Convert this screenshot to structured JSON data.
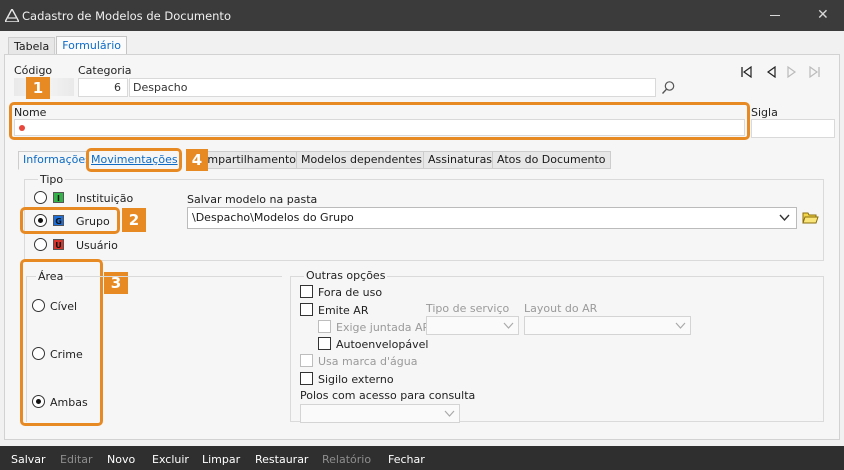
{
  "window": {
    "title": "Cadastro de Modelos de Documento"
  },
  "top_tabs": [
    {
      "label": "Tabela"
    },
    {
      "label": "Formulário"
    }
  ],
  "fields": {
    "codigo_label": "Código",
    "categoria_label": "Categoria",
    "categoria_code": "6",
    "categoria_value": "Despacho",
    "nome_label": "Nome",
    "sigla_label": "Sigla"
  },
  "badges": [
    "1",
    "2",
    "3",
    "4"
  ],
  "sub_tabs": [
    {
      "label": "Informações"
    },
    {
      "label": "Movimentações"
    },
    {
      "label": "Compartilhamentos"
    },
    {
      "label": "Modelos dependentes"
    },
    {
      "label": "Assinaturas"
    },
    {
      "label": "Atos do Documento"
    }
  ],
  "tipo": {
    "title": "Tipo",
    "options": [
      {
        "label": "Instituição",
        "icon_letter": "I",
        "icon_color": "#35b34a"
      },
      {
        "label": "Grupo",
        "icon_letter": "G",
        "icon_color": "#1e6fd9"
      },
      {
        "label": "Usuário",
        "icon_letter": "U",
        "icon_color": "#d9342b"
      }
    ],
    "selected": "Grupo"
  },
  "pasta": {
    "label": "Salvar modelo na pasta",
    "value": "\\Despacho\\Modelos do Grupo"
  },
  "area": {
    "title": "Área",
    "options": [
      {
        "label": "Cível"
      },
      {
        "label": "Crime"
      },
      {
        "label": "Ambas"
      }
    ],
    "selected": "Ambas"
  },
  "outras": {
    "title": "Outras opções",
    "fora_de_uso": "Fora de uso",
    "emite_ar": "Emite AR",
    "exige_juntada_ar": "Exige juntada AR",
    "autoenvelopavel": "Autoenvelopável",
    "usa_marca_dagua": "Usa marca d'água",
    "sigilo_externo": "Sigilo externo",
    "tipo_servico_label": "Tipo de serviço",
    "layout_ar_label": "Layout do AR",
    "polos_label": "Polos com acesso para consulta"
  },
  "bottom_buttons": [
    {
      "label": "Salvar",
      "enabled": true
    },
    {
      "label": "Editar",
      "enabled": false
    },
    {
      "label": "Novo",
      "enabled": true
    },
    {
      "label": "Excluir",
      "enabled": true
    },
    {
      "label": "Limpar",
      "enabled": true
    },
    {
      "label": "Restaurar",
      "enabled": true
    },
    {
      "label": "Relatório",
      "enabled": false
    },
    {
      "label": "Fechar",
      "enabled": true
    }
  ],
  "colors": {
    "accent": "#0d6bc6",
    "highlight": "#e88a23",
    "required": "#e8483c"
  }
}
